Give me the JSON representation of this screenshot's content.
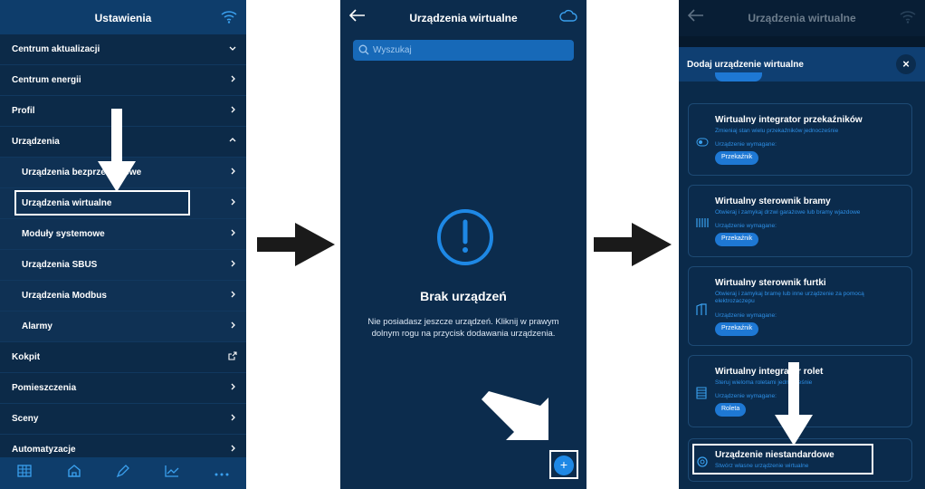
{
  "screen1": {
    "title": "Ustawienia",
    "items": [
      {
        "label": "Centrum aktualizacji",
        "chevron": "chevron-down-icon"
      },
      {
        "label": "Centrum energii",
        "chevron": "chevron-right-icon"
      },
      {
        "label": "Profil",
        "chevron": "chevron-right-icon"
      },
      {
        "label": "Urządzenia",
        "chevron": "chevron-up-icon"
      },
      {
        "label": "Urządzenia bezprzewodowe",
        "chevron": "chevron-right-icon"
      },
      {
        "label": "Urządzenia wirtualne",
        "chevron": "chevron-right-icon"
      },
      {
        "label": "Moduły systemowe",
        "chevron": "chevron-right-icon"
      },
      {
        "label": "Urządzenia SBUS",
        "chevron": "chevron-right-icon"
      },
      {
        "label": "Urządzenia Modbus",
        "chevron": "chevron-right-icon"
      },
      {
        "label": "Alarmy",
        "chevron": "chevron-right-icon"
      },
      {
        "label": "Kokpit",
        "chevron": "external-link-icon"
      },
      {
        "label": "Pomieszczenia",
        "chevron": "chevron-right-icon"
      },
      {
        "label": "Sceny",
        "chevron": "chevron-right-icon"
      },
      {
        "label": "Automatyzacje",
        "chevron": "chevron-right-icon"
      }
    ],
    "nav": [
      "grid-icon",
      "home-icon",
      "pencil-icon",
      "chart-icon",
      "more-icon"
    ]
  },
  "screen2": {
    "title": "Urządzenia wirtualne",
    "search_placeholder": "Wyszukaj",
    "empty_title": "Brak urządzeń",
    "empty_desc": "Nie posiadasz jeszcze urządzeń. Kliknij w prawym dolnym rogu na przycisk dodawania urządzenia.",
    "fab": "+"
  },
  "screen3": {
    "title": "Urządzenia wirtualne",
    "sheet_title": "Dodaj urządzenie wirtualne",
    "close": "×",
    "cards": [
      {
        "title": "Wirtualny integrator przekaźników",
        "desc": "Zmieniaj stan wielu przekaźników jednocześnie",
        "req": "Urządzenie wymagane:",
        "pill": "Przekaźnik"
      },
      {
        "title": "Wirtualny sterownik bramy",
        "desc": "Otwieraj i zamykaj drzwi garażowe lub bramy wjazdowe",
        "req": "Urządzenie wymagane:",
        "pill": "Przekaźnik"
      },
      {
        "title": "Wirtualny sterownik furtki",
        "desc": "Otwieraj i zamykaj bramę lub inne urządzenie za pomocą elektrozaczepu",
        "req": "Urządzenie wymagane:",
        "pill": "Przekaźnik"
      },
      {
        "title": "Wirtualny integrator rolet",
        "desc": "Steruj wieloma roletami jednocześnie",
        "req": "Urządzenie wymagane:",
        "pill": "Roleta"
      },
      {
        "title": "Urządzenie niestandardowe",
        "desc": "Stwórz własne urządzenie wirtualne",
        "req": "",
        "pill": ""
      }
    ]
  },
  "colors": {
    "header": "#0e3d6b",
    "background": "#0c2c4d",
    "accent": "#1e88e5"
  }
}
